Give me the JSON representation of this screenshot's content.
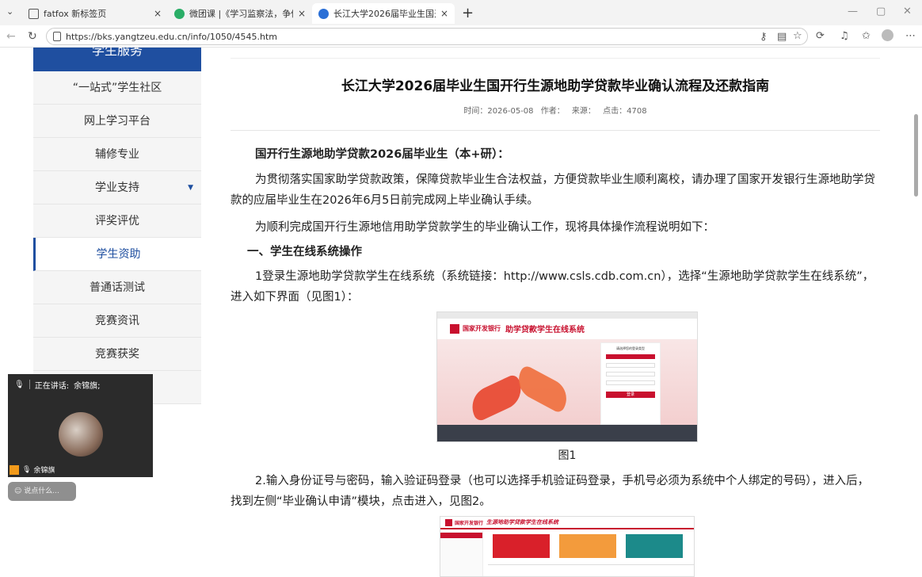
{
  "browser": {
    "tabs": [
      {
        "title": "fatfox 新标签页",
        "close": "×"
      },
      {
        "title": "微团课 |《学习监察法，争做廉洁…",
        "close": "×"
      },
      {
        "title": "长江大学2026届毕业生国开行生源…",
        "close": "×"
      }
    ],
    "new_tab": "+",
    "url": "https://bks.yangtzeu.edu.cn/info/1050/4545.htm",
    "window_controls": {
      "minimize": "—",
      "maximize": "▢",
      "close": "✕"
    }
  },
  "sidebar": {
    "header": "学生服务",
    "items": [
      {
        "label": "“一站式”学生社区"
      },
      {
        "label": "网上学习平台"
      },
      {
        "label": "辅修专业"
      },
      {
        "label": "学业支持",
        "caret": "▼"
      },
      {
        "label": "评奖评优"
      },
      {
        "label": "学生资助"
      },
      {
        "label": "普通话测试"
      },
      {
        "label": "竞赛资讯"
      },
      {
        "label": "竞赛获奖"
      }
    ]
  },
  "article": {
    "title": "长江大学2026届毕业生国开行生源地助学贷款毕业确认流程及还款指南",
    "meta": {
      "time": "时间：2026-05-08",
      "author": "作者：",
      "source": "来源：",
      "clicks": "点击：4708"
    },
    "paragraphs": [
      "国开行生源地助学贷款2026届毕业生（本+研）：",
      "为贯彻落实国家助学贷款政策，保障贷款毕业生合法权益，方便贷款毕业生顺利离校，请办理了国家开发银行生源地助学贷款的应届毕业生在2026年6月5日前完成网上毕业确认手续。",
      "为顺利完成国开行生源地信用助学贷款学生的毕业确认工作，现将具体操作流程说明如下：",
      "一、学生在线系统操作",
      "1登录生源地助学贷款学生在线系统（系统链接：http://www.csls.cdb.com.cn），选择“生源地助学贷款学生在线系统”，进入如下界面（见图1）：",
      "2.输入身份证号与密码，输入验证码登录（也可以选择手机验证码登录，手机号必须为系统中个人绑定的号码），进入后，找到左侧“毕业确认申请”模块，点击进入，见图2。"
    ],
    "figure1": {
      "caption": "图1",
      "bank_name": "国家开发银行",
      "system_title": "助学贷款学生在线系统",
      "login_title": "请选择您的登录类型",
      "login_button": "登录"
    },
    "figure2": {
      "bank_name": "国家开发银行",
      "system_title": "生源地助学贷款学生在线系统"
    }
  },
  "meeting": {
    "speaking_label": "正在讲话:",
    "speaker": "余锦旗;",
    "participant": "余锦旗",
    "chat_placeholder": "说点什么..."
  }
}
